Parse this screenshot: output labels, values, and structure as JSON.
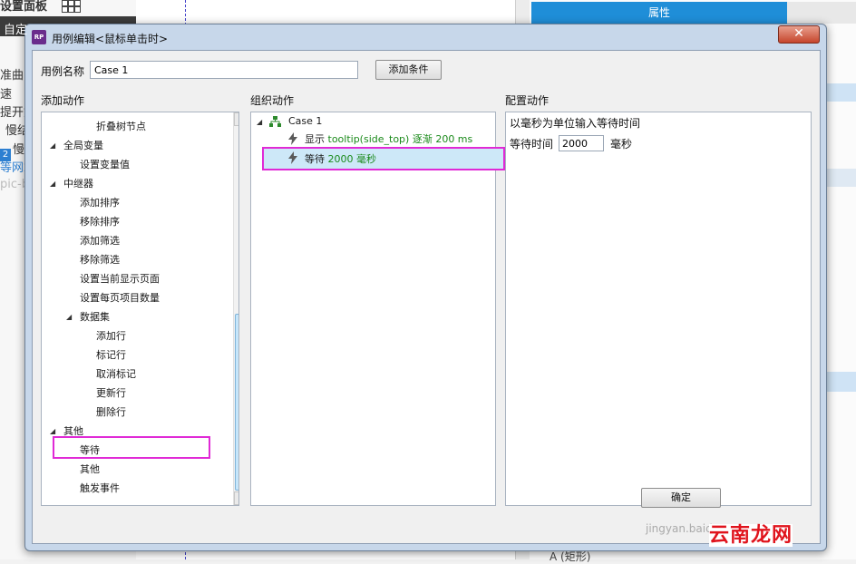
{
  "background": {
    "left_texts": [
      "设置面板",
      "自定",
      "准曲",
      "速",
      "提开如",
      "慢结",
      "慢",
      "2",
      "等网站",
      "pic-b"
    ],
    "properties_tab": "属性",
    "bottom_text": "A (矩形)"
  },
  "dialog": {
    "title": "用例编辑<鼠标单击时>",
    "close_label": "✕",
    "case_name_label": "用例名称",
    "case_name_value": "Case 1",
    "add_condition_label": "添加条件",
    "ok_label": "确定"
  },
  "add_actions": {
    "header": "添加动作",
    "rows": [
      {
        "label": "折叠树节点",
        "level": 3,
        "expand": ""
      },
      {
        "label": "全局变量",
        "level": 1,
        "expand": "◢"
      },
      {
        "label": "设置变量值",
        "level": 2,
        "expand": ""
      },
      {
        "label": "中继器",
        "level": 1,
        "expand": "◢"
      },
      {
        "label": "添加排序",
        "level": 2,
        "expand": ""
      },
      {
        "label": "移除排序",
        "level": 2,
        "expand": ""
      },
      {
        "label": "添加筛选",
        "level": 2,
        "expand": ""
      },
      {
        "label": "移除筛选",
        "level": 2,
        "expand": ""
      },
      {
        "label": "设置当前显示页面",
        "level": 2,
        "expand": ""
      },
      {
        "label": "设置每页项目数量",
        "level": 2,
        "expand": ""
      },
      {
        "label": "数据集",
        "level": 2,
        "expand": "◢"
      },
      {
        "label": "添加行",
        "level": 3,
        "expand": ""
      },
      {
        "label": "标记行",
        "level": 3,
        "expand": ""
      },
      {
        "label": "取消标记",
        "level": 3,
        "expand": ""
      },
      {
        "label": "更新行",
        "level": 3,
        "expand": ""
      },
      {
        "label": "删除行",
        "level": 3,
        "expand": ""
      },
      {
        "label": "其他",
        "level": 1,
        "expand": "◢"
      },
      {
        "label": "等待",
        "level": 2,
        "expand": ""
      },
      {
        "label": "其他",
        "level": 2,
        "expand": ""
      },
      {
        "label": "触发事件",
        "level": 2,
        "expand": ""
      }
    ]
  },
  "organize_actions": {
    "header": "组织动作",
    "case_label": "Case 1",
    "action1_prefix": "显示",
    "action1_detail": "tooltip(side_top) 逐渐 200 ms",
    "action2_prefix": "等待",
    "action2_detail": "2000 毫秒"
  },
  "configure_actions": {
    "header": "配置动作",
    "instruction": "以毫秒为单位输入等待时间",
    "wait_label": "等待时间",
    "wait_value": "2000",
    "unit": "毫秒"
  },
  "watermark": {
    "url": "jingyan.baidu",
    "brand": "云南龙网"
  },
  "colors": {
    "accent_blue": "#1f8ed8",
    "highlight_magenta": "#e02ad6",
    "selection": "#cde8f8",
    "action_green": "#1a8a1a"
  }
}
